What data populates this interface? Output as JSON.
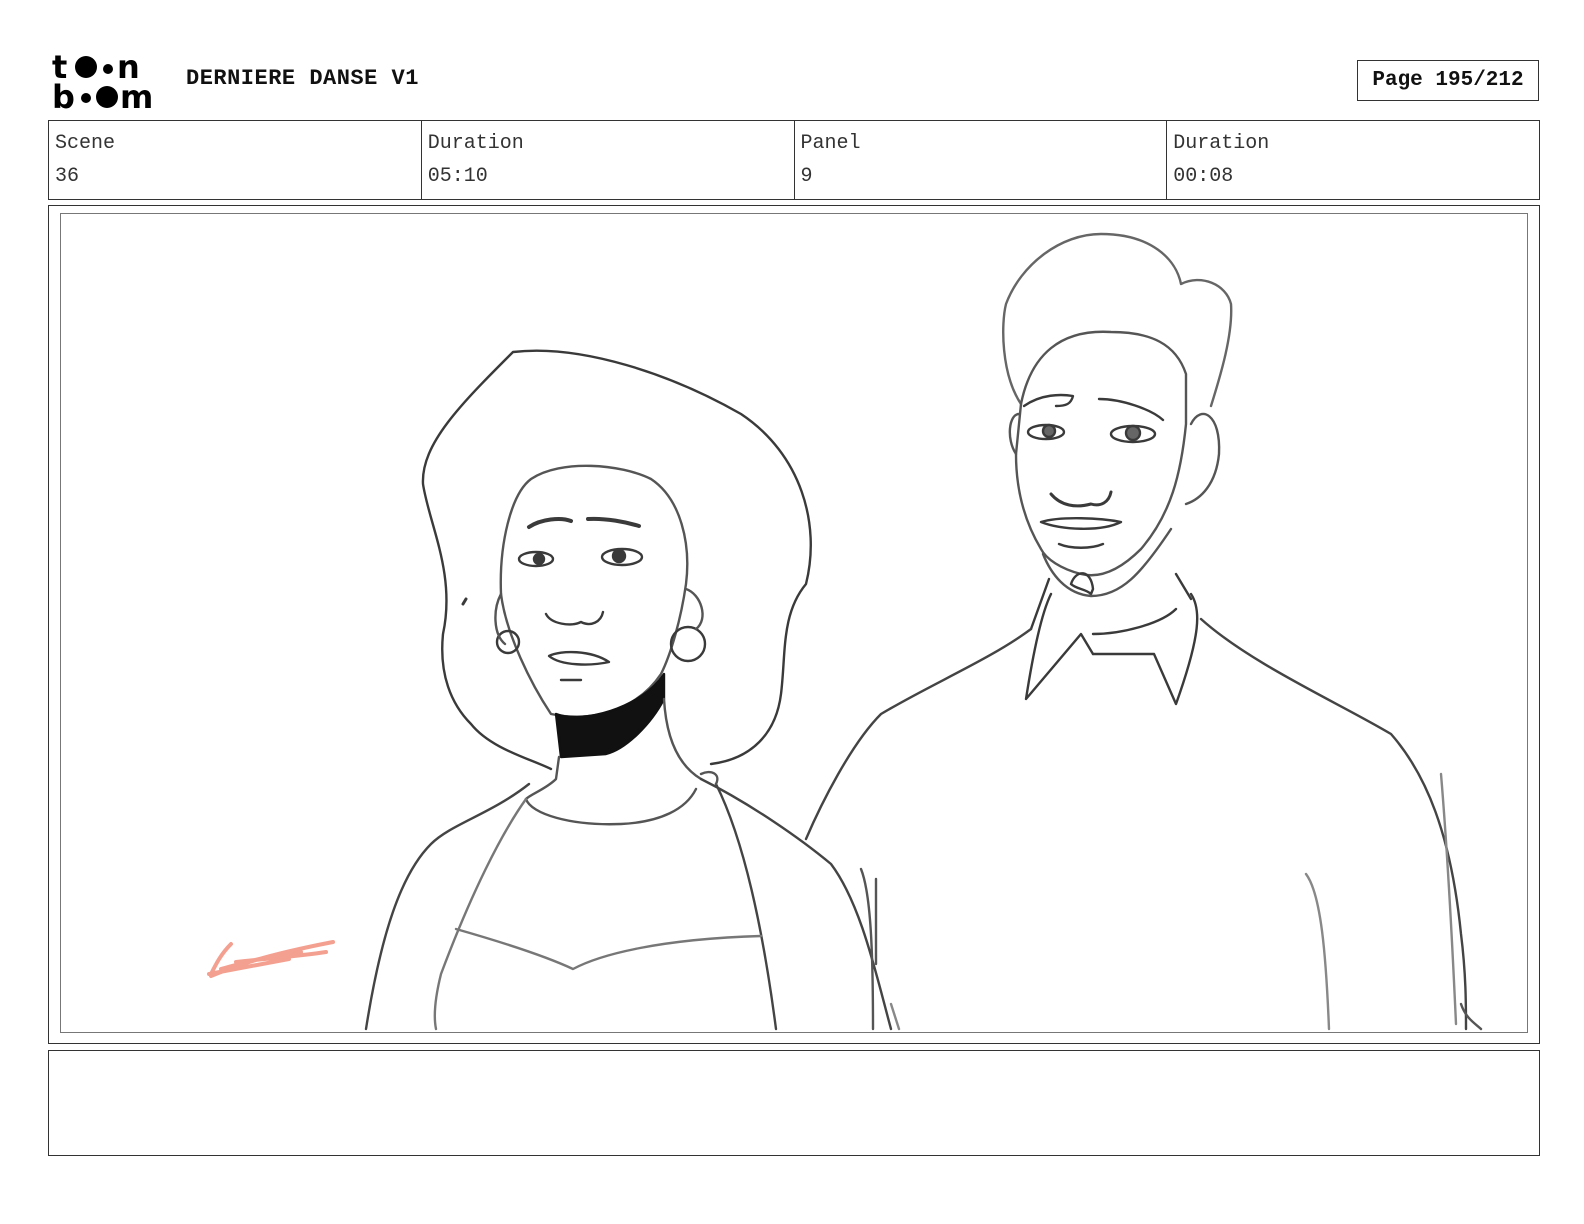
{
  "logo": {
    "line1": "toon",
    "line2": "boom"
  },
  "header": {
    "title": "DERNIERE DANSE V1",
    "page_label": "Page 195/212"
  },
  "info": {
    "scene_label": "Scene",
    "scene_value": "36",
    "scene_duration_label": "Duration",
    "scene_duration_value": "05:10",
    "panel_label": "Panel",
    "panel_value": "9",
    "panel_duration_label": "Duration",
    "panel_duration_value": "00:08"
  },
  "notes": {
    "text": ""
  },
  "colors": {
    "sketch_line": "#3a3a3a",
    "accent_mark": "#f4a090"
  }
}
